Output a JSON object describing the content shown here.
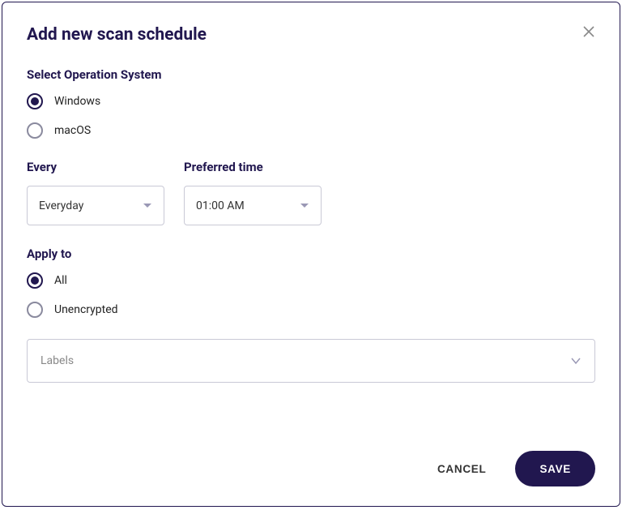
{
  "modal": {
    "title": "Add new scan schedule"
  },
  "os": {
    "label": "Select Operation System",
    "options": {
      "windows": "Windows",
      "macos": "macOS"
    },
    "selected": "windows"
  },
  "every": {
    "label": "Every",
    "value": "Everyday"
  },
  "preferred_time": {
    "label": "Preferred time",
    "value": "01:00 AM"
  },
  "apply_to": {
    "label": "Apply to",
    "options": {
      "all": "All",
      "unencrypted": "Unencrypted"
    },
    "selected": "all"
  },
  "labels": {
    "placeholder": "Labels"
  },
  "buttons": {
    "cancel": "CANCEL",
    "save": "SAVE"
  }
}
